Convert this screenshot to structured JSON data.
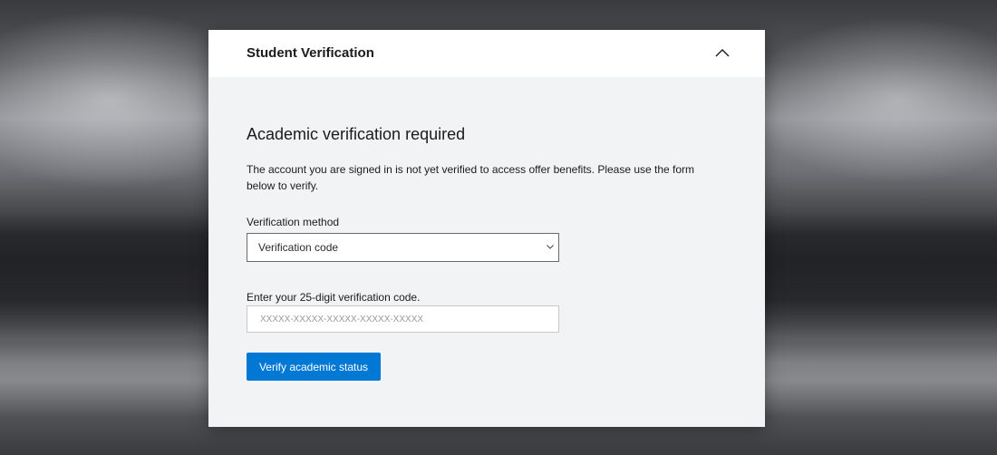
{
  "dialog": {
    "title": "Student Verification",
    "collapse_icon": "chevron-up-icon"
  },
  "content": {
    "heading": "Academic verification required",
    "description": "The account you are signed in is not yet verified to access offer benefits. Please use the form below to verify."
  },
  "form": {
    "method_label": "Verification method",
    "method_selected": "Verification code",
    "code_label": "Enter your 25-digit verification code.",
    "code_value": "",
    "code_placeholder": "XXXXX-XXXXX-XXXXX-XXXXX-XXXXX",
    "submit_label": "Verify academic status"
  },
  "colors": {
    "accent": "#0078d4",
    "header_bg": "#ffffff",
    "panel_bg": "#f2f3f5"
  }
}
